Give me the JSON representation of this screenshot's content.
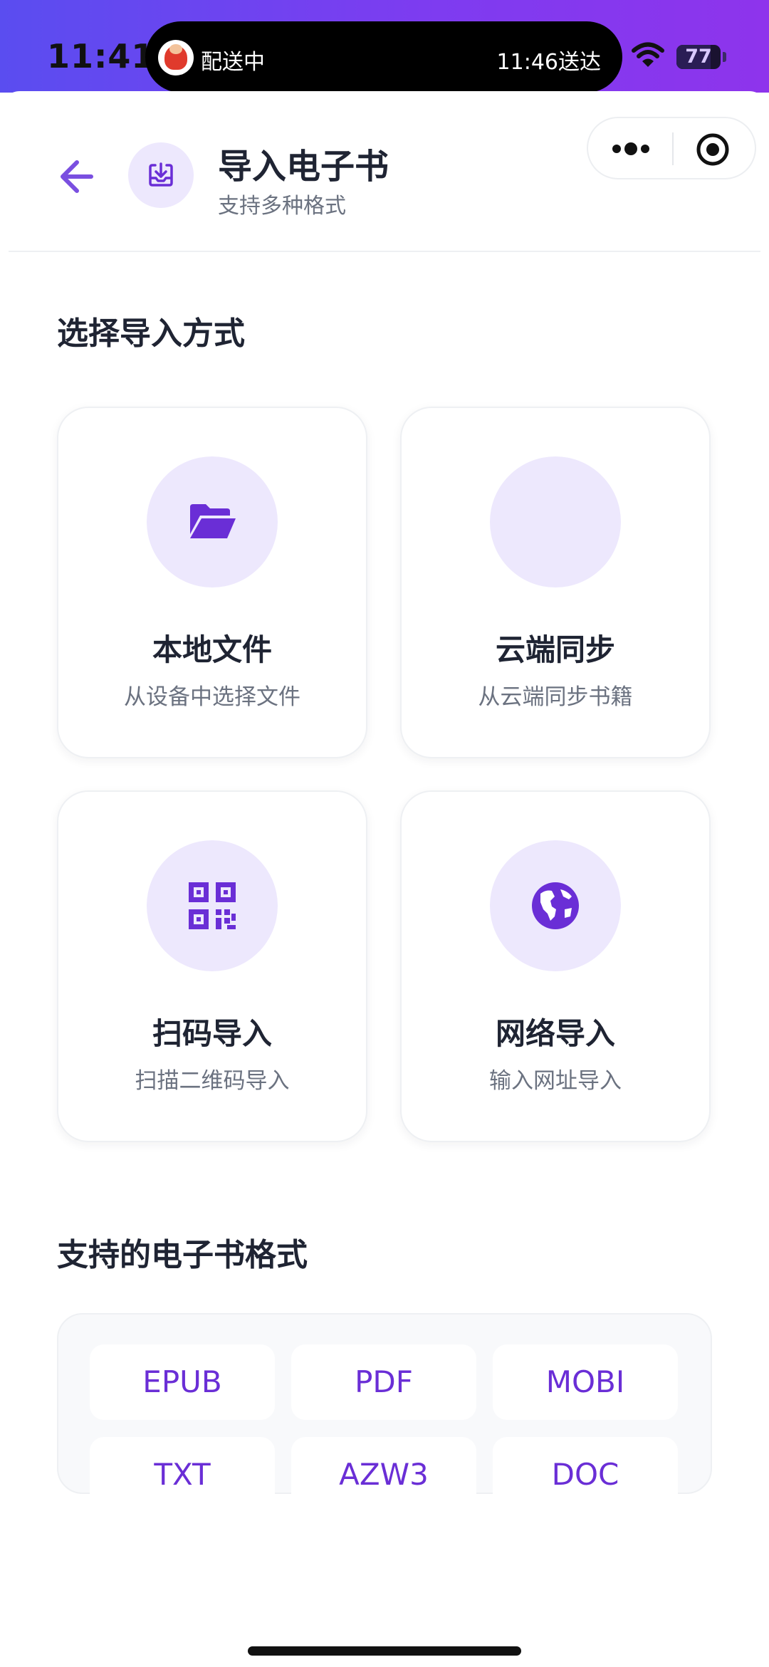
{
  "status_bar": {
    "time": "11:41",
    "live_activity_left": "配送中",
    "live_activity_right": "11:46送达",
    "battery_level": "77",
    "battery_fraction": 0.77
  },
  "header": {
    "title": "导入电子书",
    "subtitle": "支持多种格式"
  },
  "import_section": {
    "title": "选择导入方式",
    "options": [
      {
        "title": "本地文件",
        "description": "从设备中选择文件",
        "icon": "folder-open-icon"
      },
      {
        "title": "云端同步",
        "description": "从云端同步书籍",
        "icon": "cloud-icon"
      },
      {
        "title": "扫码导入",
        "description": "扫描二维码导入",
        "icon": "qr-code-icon"
      },
      {
        "title": "网络导入",
        "description": "输入网址导入",
        "icon": "globe-icon"
      }
    ]
  },
  "formats_section": {
    "title": "支持的电子书格式",
    "formats": [
      "EPUB",
      "PDF",
      "MOBI",
      "TXT",
      "AZW3",
      "DOC"
    ]
  },
  "colors": {
    "accent": "#6a2ed6",
    "accent_light": "#ede8fd",
    "status_gradient_start": "#5a4df0",
    "status_gradient_end": "#8e34ec",
    "text_primary": "#1f2433",
    "text_secondary": "#6b7280"
  }
}
